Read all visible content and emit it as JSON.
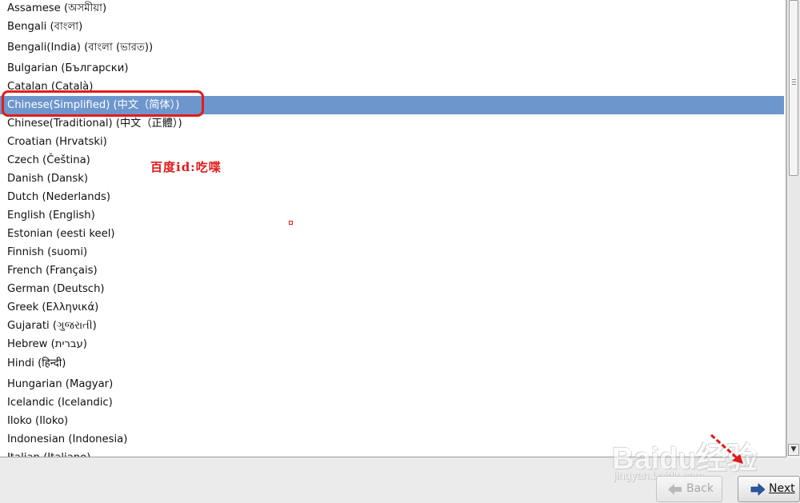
{
  "languages": [
    {
      "label": "Assamese (অসমীয়া)",
      "selected": false
    },
    {
      "label": "Bengali (বাংলা)",
      "selected": false
    },
    {
      "label": "Bengali(India) (বাংলা (ভারত))",
      "selected": false
    },
    {
      "label": "Bulgarian (Български)",
      "selected": false
    },
    {
      "label": "Catalan (Català)",
      "selected": false
    },
    {
      "label": "Chinese(Simplified) (中文（简体）)",
      "selected": true
    },
    {
      "label": "Chinese(Traditional) (中文（正體）)",
      "selected": false
    },
    {
      "label": "Croatian (Hrvatski)",
      "selected": false
    },
    {
      "label": "Czech (Čeština)",
      "selected": false
    },
    {
      "label": "Danish (Dansk)",
      "selected": false
    },
    {
      "label": "Dutch (Nederlands)",
      "selected": false
    },
    {
      "label": "English (English)",
      "selected": false
    },
    {
      "label": "Estonian (eesti keel)",
      "selected": false
    },
    {
      "label": "Finnish (suomi)",
      "selected": false
    },
    {
      "label": "French (Français)",
      "selected": false
    },
    {
      "label": "German (Deutsch)",
      "selected": false
    },
    {
      "label": "Greek (Ελληνικά)",
      "selected": false
    },
    {
      "label": "Gujarati (ગુજરાતી)",
      "selected": false
    },
    {
      "label": "Hebrew (עברית)",
      "selected": false
    },
    {
      "label": "Hindi (हिन्दी)",
      "selected": false
    },
    {
      "label": "Hungarian (Magyar)",
      "selected": false
    },
    {
      "label": "Icelandic (Icelandic)",
      "selected": false
    },
    {
      "label": "Iloko (Iloko)",
      "selected": false
    },
    {
      "label": "Indonesian (Indonesia)",
      "selected": false
    },
    {
      "label": "Italian (Italiano)",
      "selected": false
    }
  ],
  "annotation": {
    "text": "百度id:吃喋"
  },
  "buttons": {
    "back_label": "Back",
    "next_label": "Next"
  },
  "watermark": {
    "brand": "Baidu经验",
    "site": "jingyan.baidu.com"
  },
  "colors": {
    "selection": "#6d96cd",
    "highlight": "#e31b1b",
    "next_arrow": "#2b58a5"
  }
}
